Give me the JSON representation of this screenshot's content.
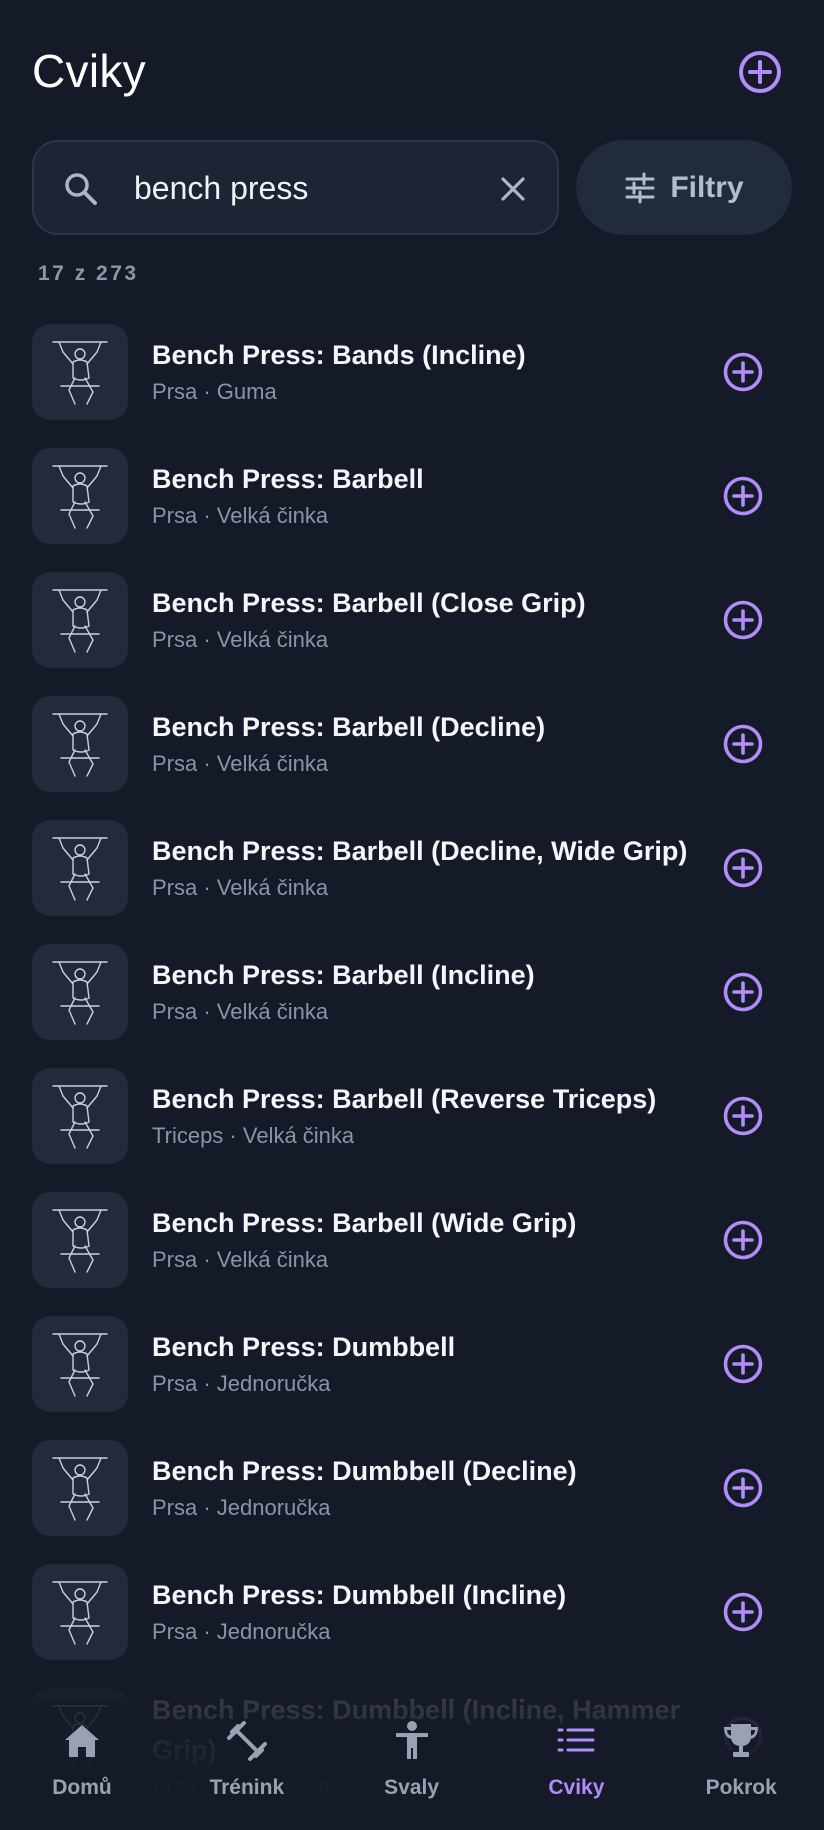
{
  "header": {
    "title": "Cviky"
  },
  "search": {
    "value": "bench press",
    "placeholder": ""
  },
  "filter": {
    "label": "Filtry"
  },
  "count_text": "17 z 273",
  "accent_color": "#b28cf8",
  "exercises": [
    {
      "name": "Bench Press: Bands (Incline)",
      "subtitle": "Prsa · Guma"
    },
    {
      "name": "Bench Press: Barbell",
      "subtitle": "Prsa · Velká činka"
    },
    {
      "name": "Bench Press: Barbell (Close Grip)",
      "subtitle": "Prsa · Velká činka"
    },
    {
      "name": "Bench Press: Barbell (Decline)",
      "subtitle": "Prsa · Velká činka"
    },
    {
      "name": "Bench Press: Barbell (Decline, Wide Grip)",
      "subtitle": "Prsa · Velká činka"
    },
    {
      "name": "Bench Press: Barbell (Incline)",
      "subtitle": "Prsa · Velká činka"
    },
    {
      "name": "Bench Press: Barbell (Reverse Triceps)",
      "subtitle": "Triceps · Velká činka"
    },
    {
      "name": "Bench Press: Barbell (Wide Grip)",
      "subtitle": "Prsa · Velká činka"
    },
    {
      "name": "Bench Press: Dumbbell",
      "subtitle": "Prsa · Jednoručka"
    },
    {
      "name": "Bench Press: Dumbbell (Decline)",
      "subtitle": "Prsa · Jednoručka"
    },
    {
      "name": "Bench Press: Dumbbell (Incline)",
      "subtitle": "Prsa · Jednoručka"
    },
    {
      "name": "Bench Press: Dumbbell (Incline, Hammer Grip)",
      "subtitle": "Prsa · Jednoručka"
    }
  ],
  "nav": {
    "items": [
      {
        "label": "Domů",
        "icon": "home-icon"
      },
      {
        "label": "Trénink",
        "icon": "dumbbell-icon"
      },
      {
        "label": "Svaly",
        "icon": "person-icon"
      },
      {
        "label": "Cviky",
        "icon": "list-icon",
        "active": true
      },
      {
        "label": "Pokrok",
        "icon": "trophy-icon"
      }
    ]
  }
}
